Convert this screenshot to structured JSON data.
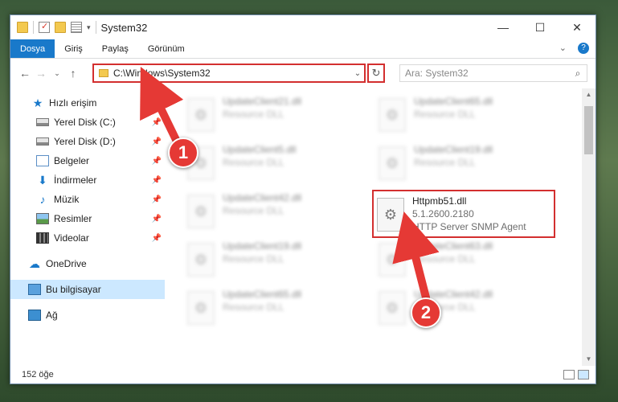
{
  "window": {
    "title": "System32",
    "controls": {
      "minimize": "—",
      "maximize": "☐",
      "close": "✕"
    }
  },
  "ribbon": {
    "tabs": [
      "Dosya",
      "Giriş",
      "Paylaş",
      "Görünüm"
    ],
    "expand_glyph": "⌄",
    "help_glyph": "?"
  },
  "nav": {
    "back": "←",
    "forward": "→",
    "recent": "⌄",
    "up": "↑",
    "address": "C:\\Windows\\System32",
    "address_dropdown": "⌄",
    "refresh": "↻",
    "search_placeholder": "Ara: System32",
    "search_glyph": "⌕"
  },
  "sidebar": {
    "quick_access": "Hızlı erişim",
    "items": [
      {
        "label": "Yerel Disk (C:)",
        "icon": "disk-icon",
        "pinned": true
      },
      {
        "label": "Yerel Disk (D:)",
        "icon": "disk-icon",
        "pinned": true
      },
      {
        "label": "Belgeler",
        "icon": "documents-icon",
        "pinned": true
      },
      {
        "label": "İndirmeler",
        "icon": "download-icon",
        "pinned": true
      },
      {
        "label": "Müzik",
        "icon": "music-icon",
        "pinned": true
      },
      {
        "label": "Resimler",
        "icon": "pictures-icon",
        "pinned": true
      },
      {
        "label": "Videolar",
        "icon": "videos-icon",
        "pinned": true
      }
    ],
    "onedrive": "OneDrive",
    "this_pc": "Bu bilgisayar",
    "network": "Ağ",
    "pin_glyph": "📌"
  },
  "files": [
    {
      "name": "UpdateClient21.dll",
      "type": "Resource DLL",
      "blurred": true
    },
    {
      "name": "UpdateClient65.dll",
      "type": "Resource DLL",
      "blurred": true
    },
    {
      "name": "UpdateClient5.dll",
      "type": "Resource DLL",
      "blurred": true
    },
    {
      "name": "UpdateClient19.dll",
      "type": "Resource DLL",
      "blurred": true
    },
    {
      "name": "UpdateClient42.dll",
      "type": "Resource DLL",
      "blurred": true
    },
    {
      "name": "Httpmb51.dll",
      "version": "5.1.2600.2180",
      "type": "HTTP Server SNMP Agent",
      "blurred": false
    },
    {
      "name": "UpdateClient19.dll",
      "type": "Resource DLL",
      "blurred": true
    },
    {
      "name": "UpdateClient63.dll",
      "type": "Resource DLL",
      "blurred": true
    },
    {
      "name": "UpdateClient65.dll",
      "type": "Resource DLL",
      "blurred": true
    },
    {
      "name": "UpdateClient42.dll",
      "type": "Resource DLL",
      "blurred": true
    }
  ],
  "status": {
    "count": "152 öğe"
  },
  "callouts": {
    "one": "1",
    "two": "2"
  },
  "colors": {
    "accent": "#1979ca",
    "highlight": "#d32f2f",
    "selected": "#cce8ff"
  }
}
